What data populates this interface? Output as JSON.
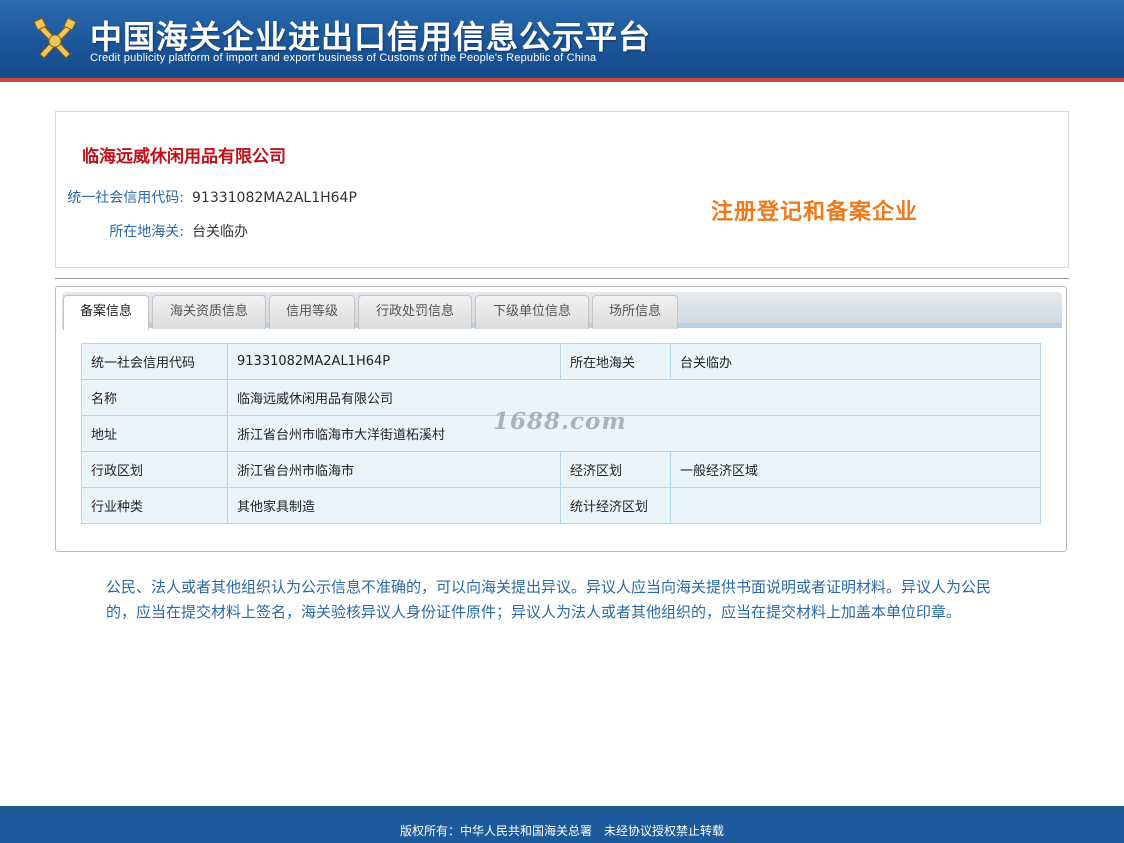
{
  "header": {
    "title": "中国海关企业进出口信用信息公示平台",
    "subtitle": "Credit publicity platform of import and export business of Customs of the People's Republic of China",
    "emblem_icon": "customs-emblem-icon"
  },
  "company": {
    "name": "临海远威休闲用品有限公司",
    "credit_code_label": "统一社会信用代码:",
    "credit_code": "91331082MA2AL1H64P",
    "customs_label": "所在地海关:",
    "customs": "台关临办",
    "badge": "注册登记和备案企业"
  },
  "tabs": [
    {
      "label": "备案信息",
      "active": true
    },
    {
      "label": "海关资质信息",
      "active": false
    },
    {
      "label": "信用等级",
      "active": false
    },
    {
      "label": "行政处罚信息",
      "active": false
    },
    {
      "label": "下级单位信息",
      "active": false
    },
    {
      "label": "场所信息",
      "active": false
    }
  ],
  "detail": {
    "rows": [
      {
        "k1": "统一社会信用代码",
        "v1": "91331082MA2AL1H64P",
        "k2": "所在地海关",
        "v2": "台关临办"
      },
      {
        "k1": "名称",
        "v1": "临海远威休闲用品有限公司"
      },
      {
        "k1": "地址",
        "v1": "浙江省台州市临海市大洋街道柘溪村"
      },
      {
        "k1": "行政区划",
        "v1": "浙江省台州市临海市",
        "k2": "经济区划",
        "v2": "一般经济区域"
      },
      {
        "k1": "行业种类",
        "v1": "其他家具制造",
        "k2": "统计经济区划",
        "v2": ""
      }
    ]
  },
  "watermark": "1688.com",
  "notice": "公民、法人或者其他组织认为公示信息不准确的，可以向海关提出异议。异议人应当向海关提供书面说明或者证明材料。异议人为公民的，应当在提交材料上签名，海关验核异议人身份证件原件；异议人为法人或者其他组织的，应当在提交材料上加盖本单位印章。",
  "footer": "版权所有：中华人民共和国海关总署　未经协议授权禁止转载",
  "colors": {
    "header_blue": "#1c569a",
    "accent_red": "#c0101a",
    "label_blue": "#2a6aa8",
    "badge_orange": "#ef7a1e",
    "table_bg": "#eaf5fa"
  }
}
